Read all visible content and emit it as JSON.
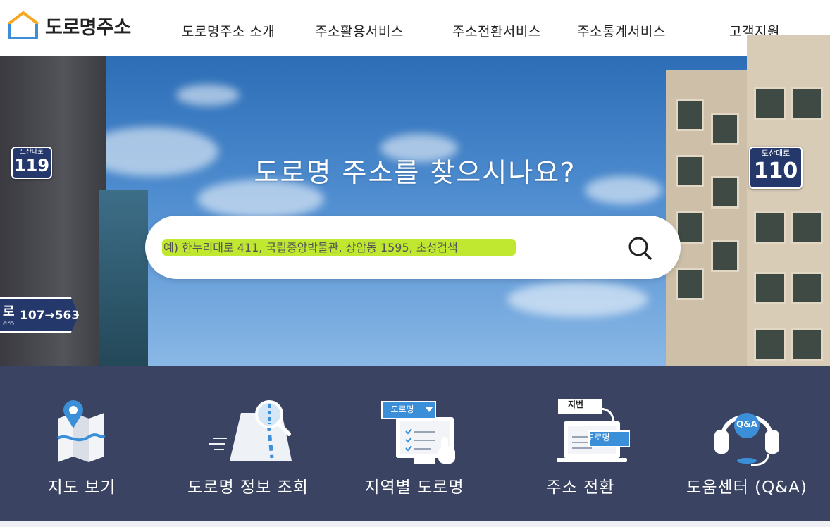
{
  "header": {
    "logo_text": "도로명주소",
    "nav": [
      {
        "label": "도로명주소 소개"
      },
      {
        "label": "주소활용서비스"
      },
      {
        "label": "주소전환서비스"
      },
      {
        "label": "주소통계서비스"
      },
      {
        "label": "고객지원"
      }
    ]
  },
  "hero": {
    "title": "도로명 주소를 찾으시나요?",
    "signs": {
      "left_top": {
        "road": "도산대로",
        "number": "119"
      },
      "right_top": {
        "road": "도산대로",
        "number": "110"
      },
      "left_arrow": {
        "road": "로",
        "romanized": "ero",
        "range": "107→563"
      }
    },
    "search": {
      "placeholder": "예) 한누리대로 411, 국립중앙박물관, 상암동 1595, 초성검색",
      "highlight_color": "#b9e51b"
    }
  },
  "menu": [
    {
      "label": "지도 보기",
      "icon": "map-pin-icon"
    },
    {
      "label": "도로명 정보 조회",
      "icon": "road-search-icon"
    },
    {
      "label": "지역별 도로명",
      "icon": "region-select-icon",
      "icon_badge": "도로명"
    },
    {
      "label": "주소 전환",
      "icon": "address-convert-icon",
      "icon_badge_top": "지번",
      "icon_badge_bottom": "도로명"
    },
    {
      "label": "도움센터 (Q&A)",
      "icon": "headset-qa-icon",
      "icon_badge": "Q&A"
    }
  ],
  "colors": {
    "menu_band": "#2b3656",
    "sign_blue": "#24386b",
    "accent_blue": "#3b8fd9",
    "logo_orange": "#f5a623"
  }
}
